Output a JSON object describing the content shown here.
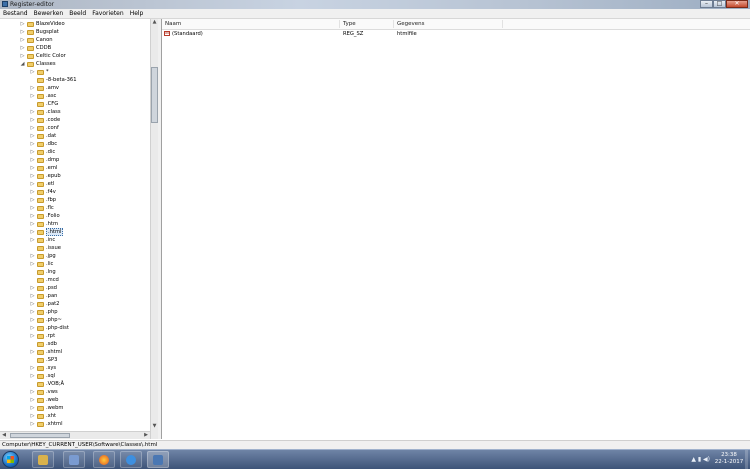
{
  "window": {
    "title": "Register-editor",
    "buttons": {
      "minimize": "–",
      "maximize": "□",
      "close": "✕"
    }
  },
  "menu": [
    "Bestand",
    "Bewerken",
    "Beeld",
    "Favorieten",
    "Help"
  ],
  "tree": {
    "items": [
      {
        "label": "BlazeVideo",
        "expander": "▷"
      },
      {
        "label": "Bugsplat",
        "expander": "▷"
      },
      {
        "label": "Canon",
        "expander": "▷"
      },
      {
        "label": "CDDB",
        "expander": "▷"
      },
      {
        "label": "Celtic Color",
        "expander": "▷"
      },
      {
        "label": "Classes",
        "expander": "◢"
      },
      {
        "label": "*",
        "expander": "▷"
      },
      {
        "label": "-8-beta-361",
        "expander": ""
      },
      {
        "label": ".amv",
        "expander": "▷"
      },
      {
        "label": ".asc",
        "expander": "▷"
      },
      {
        "label": ".CFG",
        "expander": ""
      },
      {
        "label": ".class",
        "expander": "▷"
      },
      {
        "label": ".code",
        "expander": "▷"
      },
      {
        "label": ".conf",
        "expander": "▷"
      },
      {
        "label": ".dat",
        "expander": "▷"
      },
      {
        "label": ".dbc",
        "expander": "▷"
      },
      {
        "label": ".dic",
        "expander": "▷"
      },
      {
        "label": ".dmp",
        "expander": "▷"
      },
      {
        "label": ".eml",
        "expander": "▷"
      },
      {
        "label": ".epub",
        "expander": "▷"
      },
      {
        "label": ".etl",
        "expander": "▷"
      },
      {
        "label": ".f4v",
        "expander": "▷"
      },
      {
        "label": ".fbp",
        "expander": "▷"
      },
      {
        "label": ".flc",
        "expander": "▷"
      },
      {
        "label": ".Folio",
        "expander": "▷"
      },
      {
        "label": ".htm",
        "expander": "▷"
      },
      {
        "label": ".html",
        "expander": "▷",
        "selected": true
      },
      {
        "label": ".inc",
        "expander": "▷"
      },
      {
        "label": ".issue",
        "expander": ""
      },
      {
        "label": ".jpg",
        "expander": "▷"
      },
      {
        "label": ".lic",
        "expander": "▷"
      },
      {
        "label": ".lng",
        "expander": ""
      },
      {
        "label": ".mcd",
        "expander": ""
      },
      {
        "label": ".psd",
        "expander": "▷"
      },
      {
        "label": ".pan",
        "expander": "▷"
      },
      {
        "label": ".pat2",
        "expander": "▷"
      },
      {
        "label": ".php",
        "expander": "▷"
      },
      {
        "label": ".php~",
        "expander": "▷"
      },
      {
        "label": ".php-dist",
        "expander": "▷"
      },
      {
        "label": ".rpt",
        "expander": "▷"
      },
      {
        "label": ".sdb",
        "expander": ""
      },
      {
        "label": ".shtml",
        "expander": "▷"
      },
      {
        "label": ".SP3",
        "expander": ""
      },
      {
        "label": ".sys",
        "expander": "▷"
      },
      {
        "label": ".sql",
        "expander": "▷"
      },
      {
        "label": ".VOB;Â",
        "expander": ""
      },
      {
        "label": ".vws",
        "expander": "▷"
      },
      {
        "label": ".web",
        "expander": "▷"
      },
      {
        "label": ".webm",
        "expander": "▷"
      },
      {
        "label": ".xht",
        "expander": "▷"
      },
      {
        "label": ".xhtml",
        "expander": "▷"
      }
    ]
  },
  "list": {
    "columns": [
      "Naam",
      "Type",
      "Gegevens"
    ],
    "rows": [
      {
        "name": "(Standaard)",
        "type": "REG_SZ",
        "data": "htmlfile",
        "icon_text": "ab"
      }
    ]
  },
  "status": {
    "path": "Computer\\HKEY_CURRENT_USER\\Software\\Classes\\.html"
  },
  "taskbar": {
    "apps": [
      "explorer-app",
      "media-app",
      "firefox-app",
      "internet-explorer-app",
      "registry-editor-app"
    ],
    "tray_icons": "▲ ▮ ◀)",
    "clock": {
      "time": "23:38",
      "date": "22-1-2017"
    }
  },
  "colors": {
    "folder": "#f0cd6a",
    "selection": "#dce9f8",
    "taskbar": "#3d5378"
  }
}
